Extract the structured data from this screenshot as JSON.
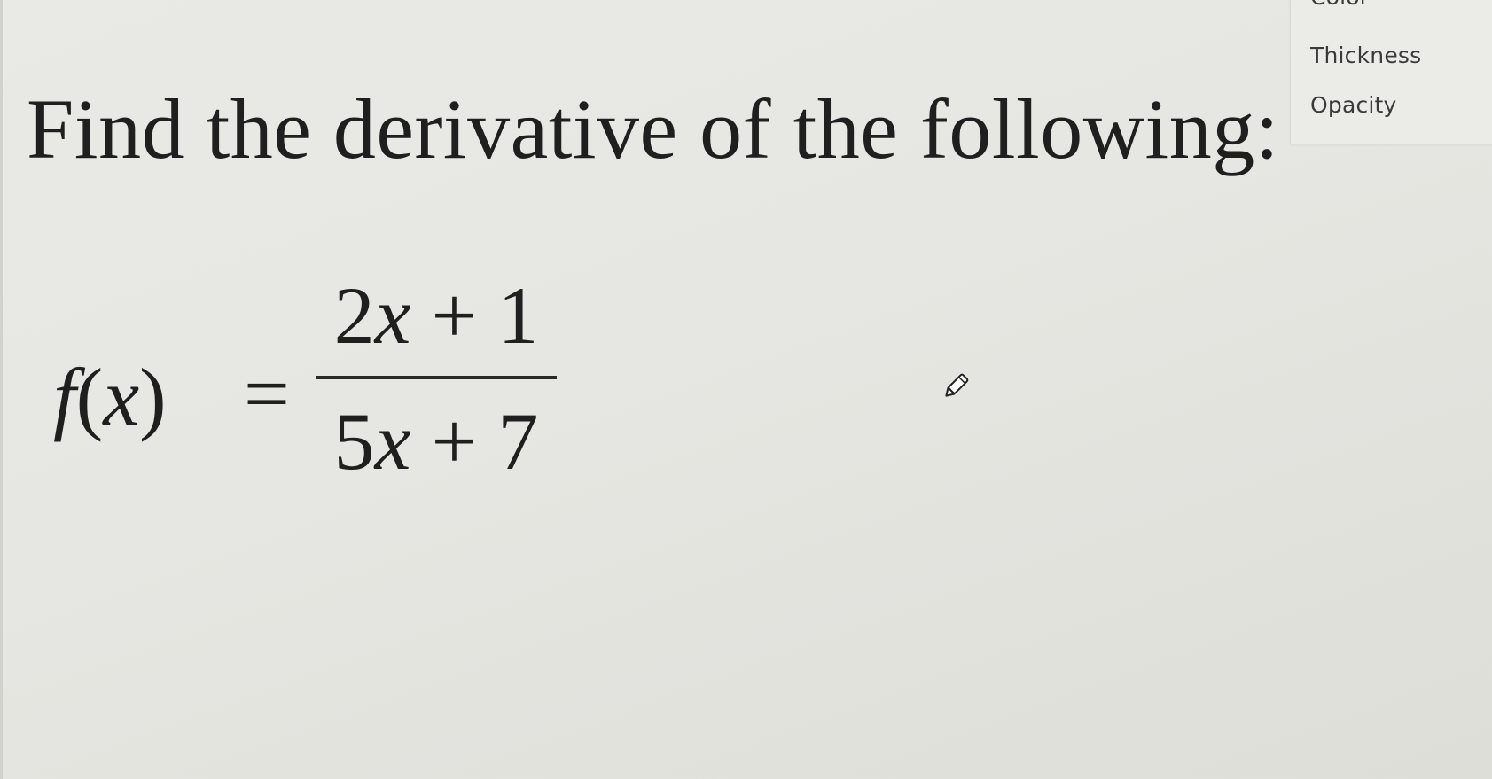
{
  "pen_options": {
    "color_label": "Color",
    "thickness_label": "Thickness",
    "opacity_label": "Opacity"
  },
  "slide": {
    "title": "Find the derivative of the following:",
    "equation": {
      "function_name": "f",
      "open_paren": "(",
      "variable": "x",
      "close_paren": ")",
      "equals": "=",
      "numerator": {
        "coefficient": "2",
        "variable": "x",
        "operator": " + ",
        "constant": "1"
      },
      "denominator": {
        "coefficient": "5",
        "variable": "x",
        "operator": " + ",
        "constant": "7"
      }
    }
  },
  "cursor": {
    "icon": "pen-cursor-icon"
  }
}
